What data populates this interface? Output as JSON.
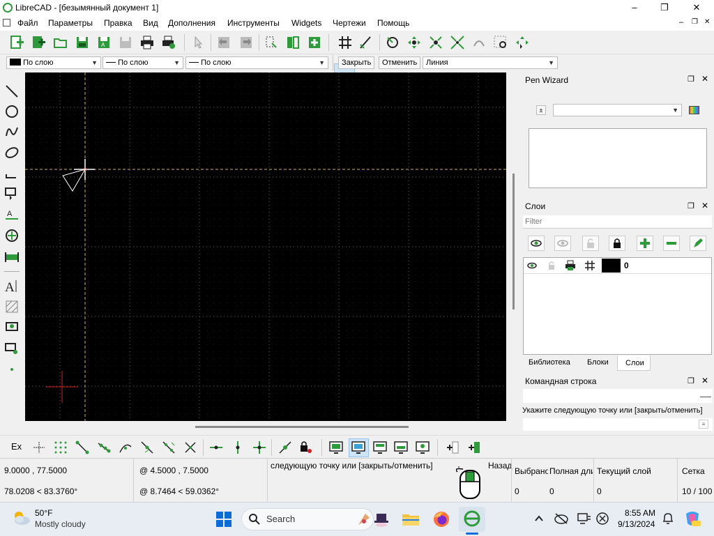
{
  "window": {
    "title": "LibreCAD - [безымянный документ 1]",
    "minimize_glyph": "–",
    "maximize_glyph": "❐",
    "close_glyph": "✕",
    "doc_min_glyph": "–",
    "doc_restore_glyph": "❐",
    "doc_close_glyph": "✕"
  },
  "menu": [
    "Файл",
    "Параметры",
    "Правка",
    "Вид",
    "Дополнения",
    "Инструменты",
    "Widgets",
    "Чертежи",
    "Помощь"
  ],
  "pen_bar": {
    "color_value": "По слою",
    "width_value": "По слою",
    "linetype_value": "По слою",
    "close_button": "Закрыть",
    "cancel_button": "Отменить",
    "tool_value": "Линия"
  },
  "pen_wizard": {
    "title": "Pen Wizard",
    "add_glyph": "±"
  },
  "layers": {
    "title": "Слои",
    "filter_placeholder": "Filter",
    "rows": [
      {
        "name": "0"
      }
    ],
    "tabs": [
      "Библиотека",
      "Блоки",
      "Слои"
    ]
  },
  "command_line": {
    "title": "Командная строка",
    "prompt": "Укажите следующую точку или [закрыть/отменить]"
  },
  "snap_bar": {
    "ex_label": "Ex"
  },
  "status": {
    "abs_coord": "9.0000 , 77.5000",
    "abs_polar": "78.0208 < 83.3760°",
    "rel_coord": "@  4.5000 , 7.5000",
    "rel_polar": "@  8.7464 < 59.0362°",
    "prompt": "следующую точку или [закрыть/отменить]",
    "back_label": "Назад",
    "selected_label": "Выбрано",
    "selected_value": "0",
    "total_label": "Полная длина",
    "total_value": "0",
    "layer_label": "Текущий слой",
    "layer_value": "0",
    "grid_label": "Сетка",
    "grid_value": "10 / 100"
  },
  "taskbar": {
    "temperature": "50°F",
    "weather": "Mostly cloudy",
    "search_placeholder": "Search",
    "time": "8:55 AM",
    "date": "9/13/2024"
  },
  "colors": {
    "canvas_bg": "#000000",
    "grid_dot": "#5a5a5a",
    "crosshair": "#c8b45a",
    "accent_green": "#2e9b3a",
    "origin_red": "#d02020"
  }
}
